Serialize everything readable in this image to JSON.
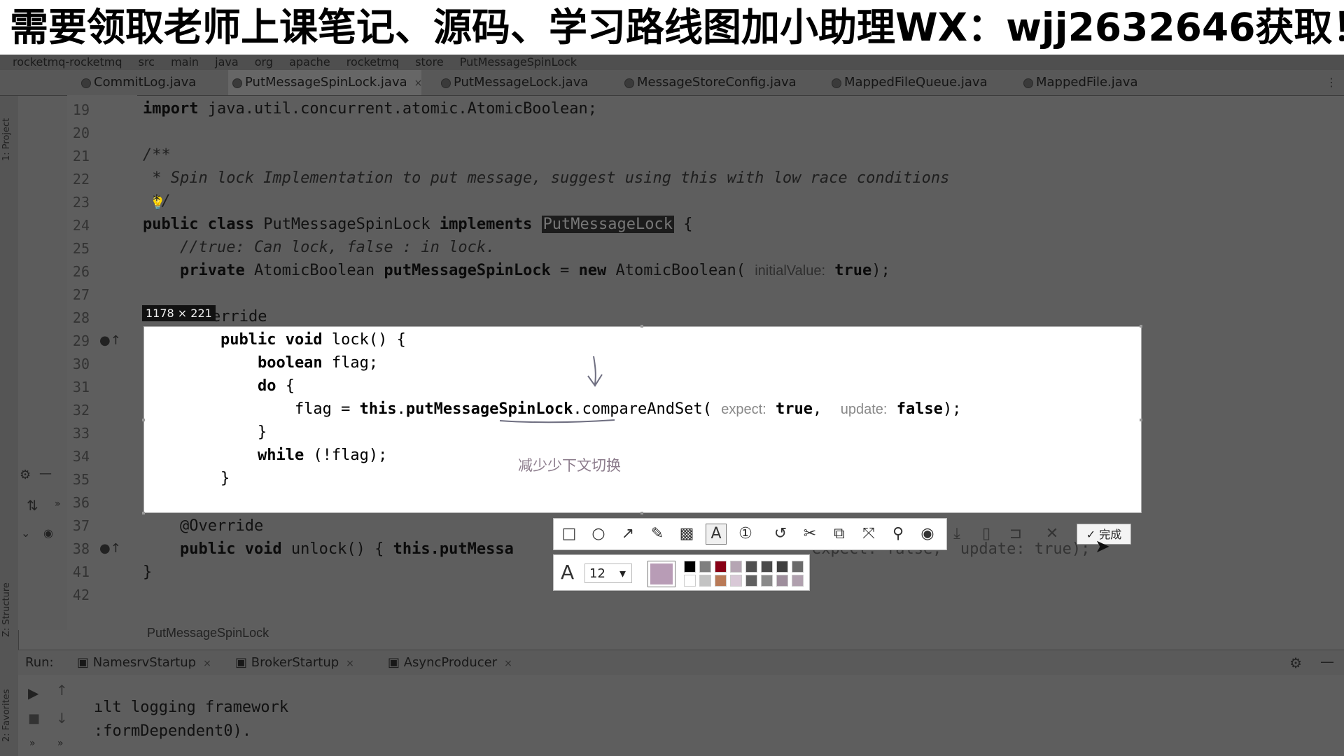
{
  "banner": {
    "text": "需要领取老师上课笔记、源码、学习路线图加小助理WX：wjj2632646获取！"
  },
  "breadcrumb_top": [
    "rocketmq-rocketmq",
    "src",
    "main",
    "java",
    "org",
    "apache",
    "rocketmq",
    "store",
    "PutMessageSpinLock"
  ],
  "tabs": [
    {
      "label": "CommitLog.java"
    },
    {
      "label": "PutMessageSpinLock.java",
      "close": "×"
    },
    {
      "label": "PutMessageLock.java"
    },
    {
      "label": "MessageStoreConfig.java"
    },
    {
      "label": "MappedFileQueue.java"
    },
    {
      "label": "MappedFile.java"
    }
  ],
  "side_labels": {
    "project": "1: Project",
    "structure": "Z: Structure",
    "favorites": "2: Favorites"
  },
  "line_numbers": [
    "19",
    "20",
    "21",
    "22",
    "23",
    "24",
    "25",
    "26",
    "27",
    "28",
    "29",
    "30",
    "31",
    "32",
    "33",
    "34",
    "35",
    "36",
    "37",
    "38",
    "41",
    "42"
  ],
  "code": {
    "l19_kw": "import",
    "l19": " java.util.concurrent.atomic.AtomicBoolean;",
    "l21": "/**",
    "l22": " * Spin lock Implementation to put message, suggest using this with low race conditions",
    "l23": " */",
    "l24_kw1": "public class",
    "l24_name": " PutMessageSpinLock ",
    "l24_kw2": "implements",
    "l24_hl": "PutMessageLock",
    "l24_end": " {",
    "l25": "    //true: Can lock, false : in lock.",
    "l26_kw": "    private",
    "l26_a": " AtomicBoolean ",
    "l26_b": "putMessageSpinLock",
    "l26_c": " = ",
    "l26_kw2": "new",
    "l26_d": " AtomicBoolean( ",
    "l26_hint": "initialValue:",
    "l26_kw3": " true",
    "l26_e": ");",
    "l28": "erride",
    "l29_kw": "    public void",
    "l29": " lock() {",
    "l30_kw": "        boolean",
    "l30": " flag;",
    "l31_kw": "        do",
    "l31": " {",
    "l32_a": "            flag = ",
    "l32_kw": "this",
    "l32_b": ".",
    "l32_field": "putMessageSpinLock",
    "l32_c": ".compareAndSet( ",
    "l32_h1": "expect:",
    "l32_kw2": " true",
    "l32_d": ",  ",
    "l32_h2": "update:",
    "l32_kw3": " false",
    "l32_e": ");",
    "l33": "        }",
    "l34_kw": "        while",
    "l34": " (!flag);",
    "l35": "    }",
    "l37": "    @Override",
    "l38_kw": "    public void",
    "l38_a": " unlock() { ",
    "l38_kw2": "this",
    "l38_b": ".putMessa",
    "l38_tail": "expect: false,  update: true);",
    "l41": "}"
  },
  "selection": {
    "size": "1178 × 221"
  },
  "annotation": {
    "text": "减少少下文切换"
  },
  "toolbar": {
    "tools": [
      "rectangle-icon",
      "ellipse-icon",
      "arrow-icon",
      "pencil-icon",
      "mosaic-icon",
      "text-icon",
      "number-icon",
      "undo-icon",
      "cut-icon",
      "translate-icon",
      "expand-icon",
      "pin-icon",
      "record-icon",
      "download-icon",
      "long-screenshot-icon",
      "bookmark-icon",
      "close-icon"
    ],
    "done": "✓ 完成"
  },
  "fontbar": {
    "size": "12",
    "dropdown": "▾",
    "letter": "A"
  },
  "file_breadcrumb": "PutMessageSpinLock",
  "run": {
    "label": "Run:",
    "tabs": [
      {
        "label": "NamesrvStartup",
        "close": "×"
      },
      {
        "label": "BrokerStartup",
        "close": "×"
      },
      {
        "label": "AsyncProducer",
        "close": "×"
      }
    ],
    "lines": [
      "ılt logging framework",
      ":formDependent0)."
    ]
  }
}
